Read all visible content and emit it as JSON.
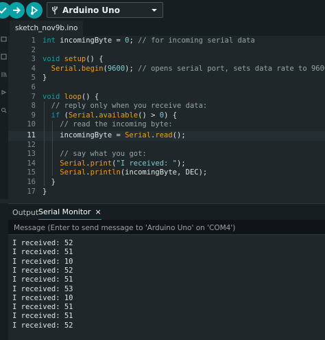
{
  "toolbar": {
    "board": "Arduino Uno",
    "icons": {
      "verify": "checkmark-icon",
      "upload": "arrow-right-icon",
      "debug": "debug-icon",
      "usb": "usb-icon",
      "dropdown": "chevron-down-icon"
    }
  },
  "tabs": [
    {
      "label": "sketch_nov9b.ino"
    }
  ],
  "editor": {
    "line_numbers": [
      "1",
      "2",
      "3",
      "4",
      "5",
      "6",
      "7",
      "8",
      "9",
      "10",
      "11",
      "12",
      "13",
      "14",
      "15",
      "16",
      "17"
    ],
    "active_line": 11
  },
  "panel": {
    "tabs": {
      "output": "Output",
      "serial_monitor": "Serial Monitor",
      "close": "×"
    },
    "message_placeholder": "Message (Enter to send message to 'Arduino Uno' on 'COM4')",
    "serial_lines": [
      "I received: 52",
      "I received: 51",
      "I received: 10",
      "I received: 52",
      "I received: 51",
      "I received: 53",
      "I received: 10",
      "I received: 51",
      "I received: 51",
      "I received: 52"
    ]
  },
  "colors": {
    "accent": "#0ca1a6",
    "function": "#f39c12",
    "comment": "#95a5a6",
    "background": "#1f272a"
  }
}
